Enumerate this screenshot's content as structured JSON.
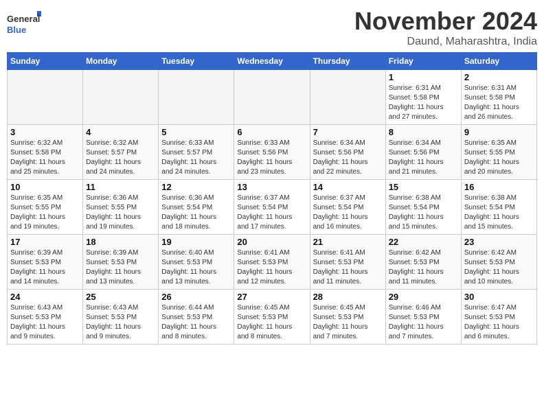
{
  "logo": {
    "general": "General",
    "blue": "Blue"
  },
  "title": "November 2024",
  "location": "Daund, Maharashtra, India",
  "weekdays": [
    "Sunday",
    "Monday",
    "Tuesday",
    "Wednesday",
    "Thursday",
    "Friday",
    "Saturday"
  ],
  "weeks": [
    [
      {
        "day": "",
        "info": ""
      },
      {
        "day": "",
        "info": ""
      },
      {
        "day": "",
        "info": ""
      },
      {
        "day": "",
        "info": ""
      },
      {
        "day": "",
        "info": ""
      },
      {
        "day": "1",
        "info": "Sunrise: 6:31 AM\nSunset: 5:58 PM\nDaylight: 11 hours\nand 27 minutes."
      },
      {
        "day": "2",
        "info": "Sunrise: 6:31 AM\nSunset: 5:58 PM\nDaylight: 11 hours\nand 26 minutes."
      }
    ],
    [
      {
        "day": "3",
        "info": "Sunrise: 6:32 AM\nSunset: 5:58 PM\nDaylight: 11 hours\nand 25 minutes."
      },
      {
        "day": "4",
        "info": "Sunrise: 6:32 AM\nSunset: 5:57 PM\nDaylight: 11 hours\nand 24 minutes."
      },
      {
        "day": "5",
        "info": "Sunrise: 6:33 AM\nSunset: 5:57 PM\nDaylight: 11 hours\nand 24 minutes."
      },
      {
        "day": "6",
        "info": "Sunrise: 6:33 AM\nSunset: 5:56 PM\nDaylight: 11 hours\nand 23 minutes."
      },
      {
        "day": "7",
        "info": "Sunrise: 6:34 AM\nSunset: 5:56 PM\nDaylight: 11 hours\nand 22 minutes."
      },
      {
        "day": "8",
        "info": "Sunrise: 6:34 AM\nSunset: 5:56 PM\nDaylight: 11 hours\nand 21 minutes."
      },
      {
        "day": "9",
        "info": "Sunrise: 6:35 AM\nSunset: 5:55 PM\nDaylight: 11 hours\nand 20 minutes."
      }
    ],
    [
      {
        "day": "10",
        "info": "Sunrise: 6:35 AM\nSunset: 5:55 PM\nDaylight: 11 hours\nand 19 minutes."
      },
      {
        "day": "11",
        "info": "Sunrise: 6:36 AM\nSunset: 5:55 PM\nDaylight: 11 hours\nand 19 minutes."
      },
      {
        "day": "12",
        "info": "Sunrise: 6:36 AM\nSunset: 5:54 PM\nDaylight: 11 hours\nand 18 minutes."
      },
      {
        "day": "13",
        "info": "Sunrise: 6:37 AM\nSunset: 5:54 PM\nDaylight: 11 hours\nand 17 minutes."
      },
      {
        "day": "14",
        "info": "Sunrise: 6:37 AM\nSunset: 5:54 PM\nDaylight: 11 hours\nand 16 minutes."
      },
      {
        "day": "15",
        "info": "Sunrise: 6:38 AM\nSunset: 5:54 PM\nDaylight: 11 hours\nand 15 minutes."
      },
      {
        "day": "16",
        "info": "Sunrise: 6:38 AM\nSunset: 5:54 PM\nDaylight: 11 hours\nand 15 minutes."
      }
    ],
    [
      {
        "day": "17",
        "info": "Sunrise: 6:39 AM\nSunset: 5:53 PM\nDaylight: 11 hours\nand 14 minutes."
      },
      {
        "day": "18",
        "info": "Sunrise: 6:39 AM\nSunset: 5:53 PM\nDaylight: 11 hours\nand 13 minutes."
      },
      {
        "day": "19",
        "info": "Sunrise: 6:40 AM\nSunset: 5:53 PM\nDaylight: 11 hours\nand 13 minutes."
      },
      {
        "day": "20",
        "info": "Sunrise: 6:41 AM\nSunset: 5:53 PM\nDaylight: 11 hours\nand 12 minutes."
      },
      {
        "day": "21",
        "info": "Sunrise: 6:41 AM\nSunset: 5:53 PM\nDaylight: 11 hours\nand 11 minutes."
      },
      {
        "day": "22",
        "info": "Sunrise: 6:42 AM\nSunset: 5:53 PM\nDaylight: 11 hours\nand 11 minutes."
      },
      {
        "day": "23",
        "info": "Sunrise: 6:42 AM\nSunset: 5:53 PM\nDaylight: 11 hours\nand 10 minutes."
      }
    ],
    [
      {
        "day": "24",
        "info": "Sunrise: 6:43 AM\nSunset: 5:53 PM\nDaylight: 11 hours\nand 9 minutes."
      },
      {
        "day": "25",
        "info": "Sunrise: 6:43 AM\nSunset: 5:53 PM\nDaylight: 11 hours\nand 9 minutes."
      },
      {
        "day": "26",
        "info": "Sunrise: 6:44 AM\nSunset: 5:53 PM\nDaylight: 11 hours\nand 8 minutes."
      },
      {
        "day": "27",
        "info": "Sunrise: 6:45 AM\nSunset: 5:53 PM\nDaylight: 11 hours\nand 8 minutes."
      },
      {
        "day": "28",
        "info": "Sunrise: 6:45 AM\nSunset: 5:53 PM\nDaylight: 11 hours\nand 7 minutes."
      },
      {
        "day": "29",
        "info": "Sunrise: 6:46 AM\nSunset: 5:53 PM\nDaylight: 11 hours\nand 7 minutes."
      },
      {
        "day": "30",
        "info": "Sunrise: 6:47 AM\nSunset: 5:53 PM\nDaylight: 11 hours\nand 6 minutes."
      }
    ]
  ]
}
